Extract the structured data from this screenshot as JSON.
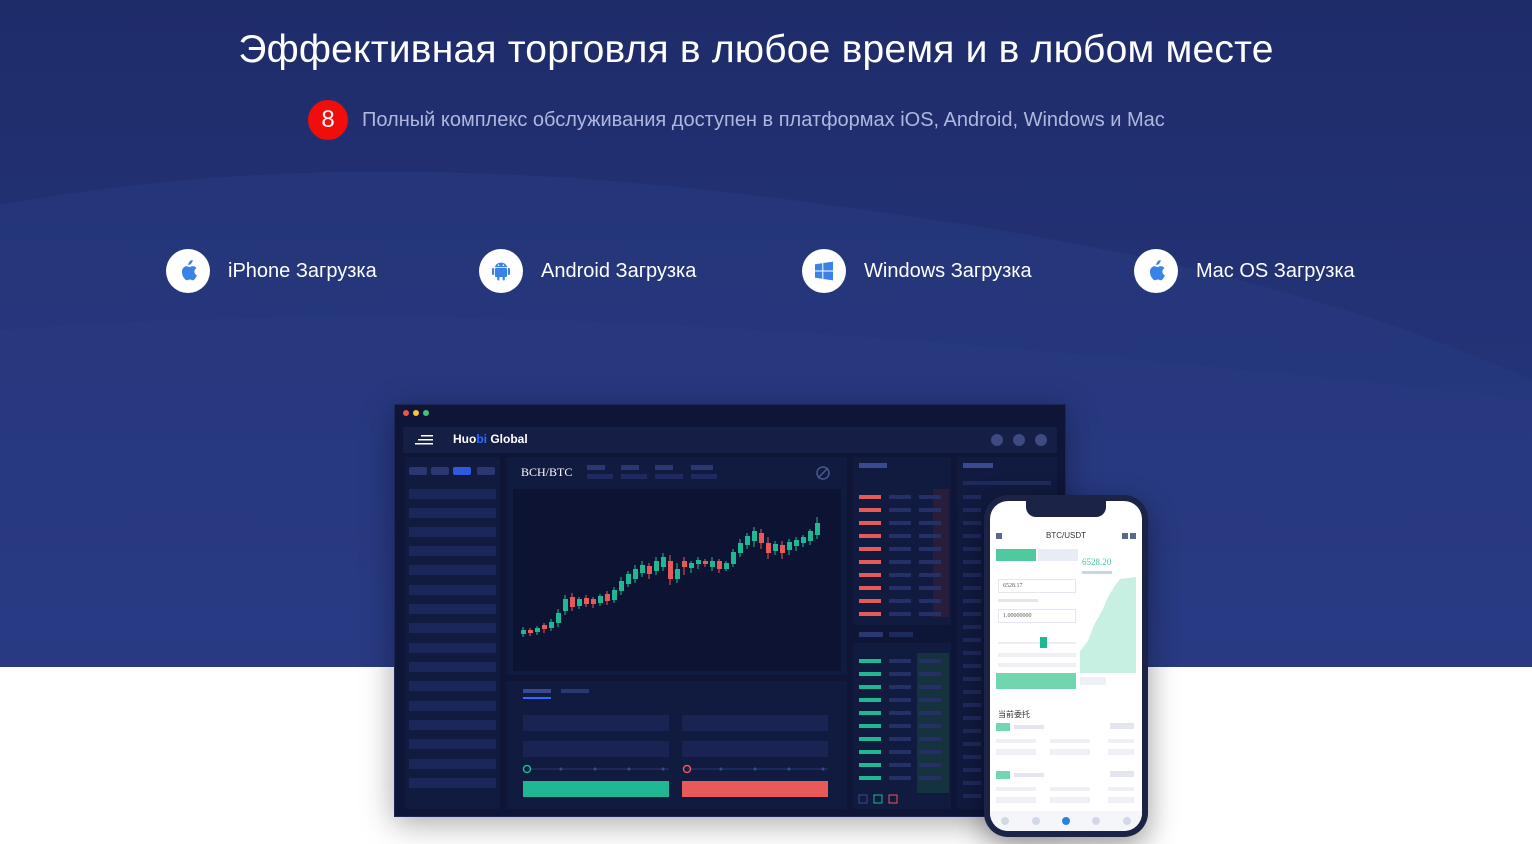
{
  "hero": {
    "title": "Эффективная торговля в любое время и в любом месте",
    "badge": "8",
    "subtitle": "Полный комплекс обслуживания доступен в платформах iOS, Android, Windows и Mac"
  },
  "downloads": [
    {
      "label": "iPhone Загрузка",
      "icon": "apple-icon"
    },
    {
      "label": "Android Загрузка",
      "icon": "android-icon"
    },
    {
      "label": "Windows Загрузка",
      "icon": "windows-icon"
    },
    {
      "label": "Mac OS Загрузка",
      "icon": "apple-icon"
    }
  ],
  "desktop_app": {
    "brand_prefix": "Huo",
    "brand_accent": "bi",
    "brand_suffix": " Global",
    "pair": "BCH/BTC"
  },
  "mobile_app": {
    "pair": "BTC/USDT",
    "price": "6528.20",
    "price_input": "6528.17",
    "amount_input": "1.00000000",
    "section_title": "当前委托"
  },
  "colors": {
    "hero_bg": "#233377",
    "badge": "#f20d0d",
    "buy": "#1fb892",
    "sell": "#e85a5a",
    "accent": "#2f6bff"
  }
}
